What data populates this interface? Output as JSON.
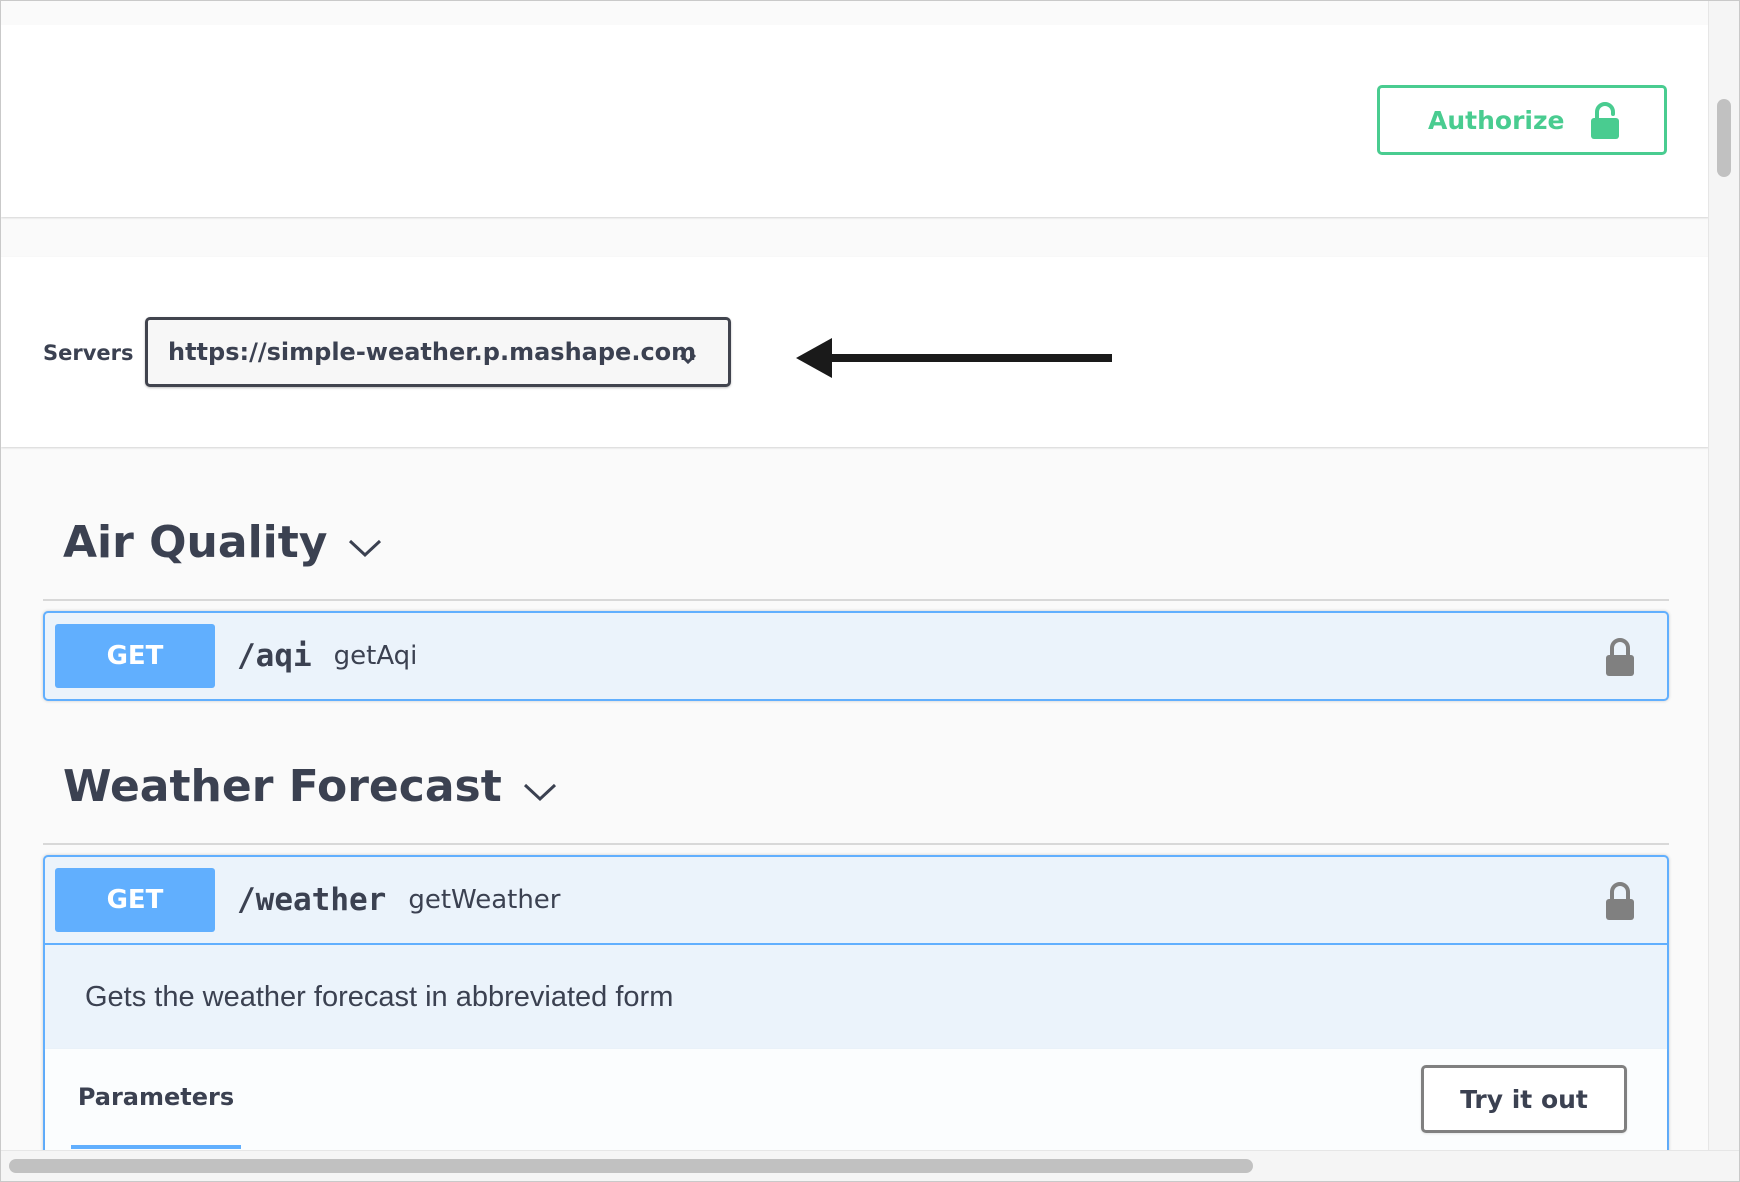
{
  "header": {
    "authorize_label": "Authorize"
  },
  "servers": {
    "label": "Servers",
    "selected": "https://simple-weather.p.mashape.com"
  },
  "sections": [
    {
      "title": "Air Quality",
      "operations": [
        {
          "method": "GET",
          "path": "/aqi",
          "operation_id": "getAqi"
        }
      ]
    },
    {
      "title": "Weather Forecast",
      "operations": [
        {
          "method": "GET",
          "path": "/weather",
          "operation_id": "getWeather",
          "description": "Gets the weather forecast in abbreviated form",
          "parameters_tab": "Parameters",
          "try_label": "Try it out"
        }
      ]
    }
  ],
  "icons": {
    "authorize": "unlocked-padlock-icon",
    "operation_lock": "padlock-icon",
    "select_chevron": "chevron-down-icon",
    "section_chevron": "chevron-down-icon",
    "annotation": "left-arrow-icon"
  },
  "colors": {
    "authorize_green": "#49cc90",
    "get_blue": "#61affe",
    "get_bg": "#ebf3fb",
    "text": "#3b4151",
    "lock_gray": "#808080"
  }
}
